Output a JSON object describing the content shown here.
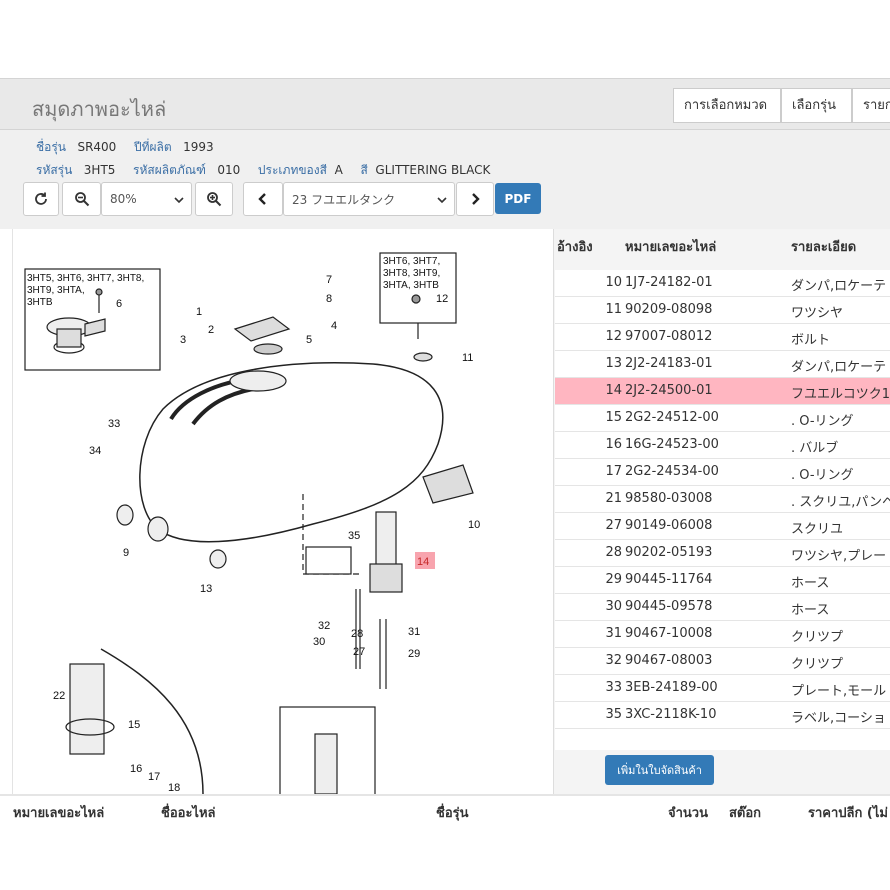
{
  "header": {
    "title": "สมุดภาพอะไหล่",
    "nav": [
      "การเลือกหมวด",
      "เลือกรุ่น",
      "รายการ"
    ]
  },
  "model_info": {
    "model_name_label": "ชื่อรุ่น",
    "model_name": "SR400",
    "year_label": "ปีที่ผลิต",
    "year": "1993",
    "model_code_label": "รหัสรุ่น",
    "model_code": "3HT5",
    "product_code_label": "รหัสผลิตภัณฑ์",
    "product_code": "010",
    "country_label": "ประเภทของสี",
    "country": "A",
    "color_label": "สี",
    "color": "GLITTERING BLACK"
  },
  "toolbar": {
    "zoom": "80%",
    "category": "23 フユエルタンク",
    "pdf": "PDF"
  },
  "diagram": {
    "inset_left": [
      "3HT5, 3HT6, 3HT7, 3HT8,",
      "3HT9, 3HTA,",
      "3HTB"
    ],
    "inset_right": [
      "3HT6, 3HT7,",
      "3HT8, 3HT9,",
      "3HTA, 3HTB"
    ],
    "callouts": [
      "1",
      "2",
      "3",
      "4",
      "5",
      "6",
      "7",
      "8",
      "9",
      "10",
      "11",
      "12",
      "13",
      "14",
      "15",
      "16",
      "17",
      "18",
      "22",
      "27",
      "28",
      "29",
      "30",
      "31",
      "32",
      "33",
      "34",
      "35"
    ],
    "highlight": "14"
  },
  "parts_table": {
    "headers": [
      "อ้างอิง",
      "หมายเลขอะไหล่",
      "รายละเอียด"
    ],
    "rows": [
      {
        "ref": "10",
        "part": "1J7-24182-01",
        "desc": "ダンパ,ロケーテ"
      },
      {
        "ref": "11",
        "part": "90209-08098",
        "desc": "ワツシヤ"
      },
      {
        "ref": "12",
        "part": "97007-08012",
        "desc": "ボルト"
      },
      {
        "ref": "13",
        "part": "2J2-24183-01",
        "desc": "ダンパ,ロケーテ"
      },
      {
        "ref": "14",
        "part": "2J2-24500-01",
        "desc": "フユエルコツク1"
      },
      {
        "ref": "15",
        "part": "2G2-24512-00",
        "desc": ". O-リング"
      },
      {
        "ref": "16",
        "part": "16G-24523-00",
        "desc": ". バルブ"
      },
      {
        "ref": "17",
        "part": "2G2-24534-00",
        "desc": ". O-リング"
      },
      {
        "ref": "21",
        "part": "98580-03008",
        "desc": ". スクリユ,パンヘ"
      },
      {
        "ref": "27",
        "part": "90149-06008",
        "desc": "スクリユ"
      },
      {
        "ref": "28",
        "part": "90202-05193",
        "desc": "ワツシヤ,プレー"
      },
      {
        "ref": "29",
        "part": "90445-11764",
        "desc": "ホース"
      },
      {
        "ref": "30",
        "part": "90445-09578",
        "desc": "ホース"
      },
      {
        "ref": "31",
        "part": "90467-10008",
        "desc": "クリツプ"
      },
      {
        "ref": "32",
        "part": "90467-08003",
        "desc": "クリツプ"
      },
      {
        "ref": "33",
        "part": "3EB-24189-00",
        "desc": "プレート,モール"
      },
      {
        "ref": "35",
        "part": "3XC-2118K-10",
        "desc": "ラベル,コーショ"
      }
    ],
    "add_button": "เพิ่มในใบจัดสินค้า"
  },
  "order_table": {
    "headers": [
      "หมายเลขอะไหล่",
      "ชื่ออะไหล่",
      "ชื่อรุ่น",
      "จำนวน",
      "สต๊อก",
      "ราคาปลีก (ไม่"
    ]
  }
}
